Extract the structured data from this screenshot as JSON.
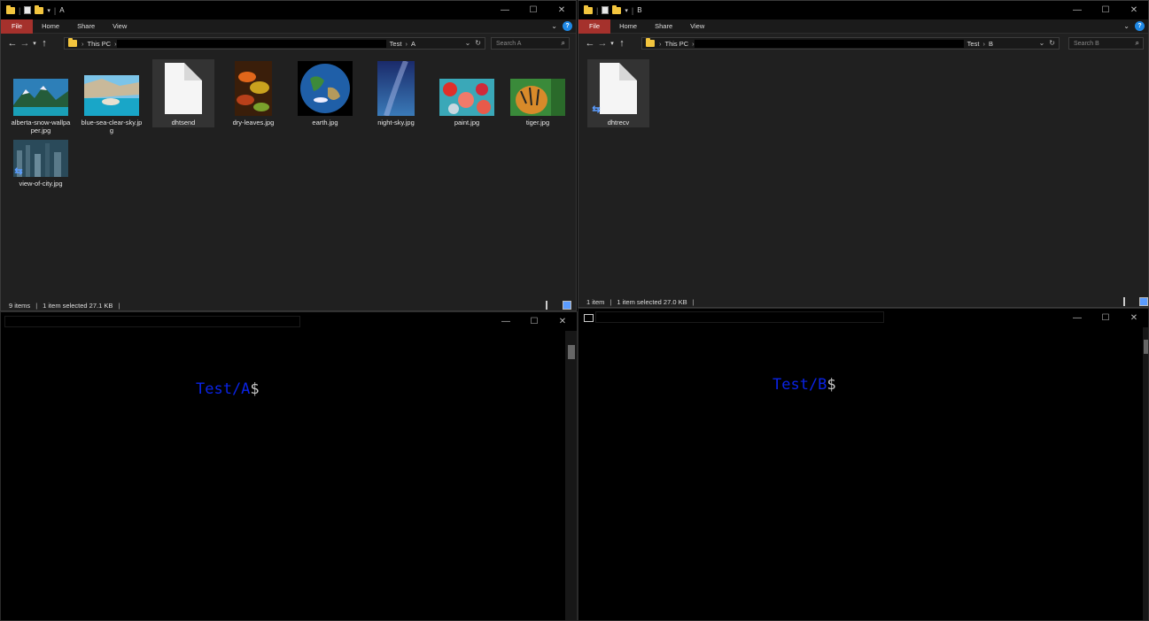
{
  "explorer_a": {
    "title": "A",
    "tabs": [
      "File",
      "Home",
      "Share",
      "View"
    ],
    "address": {
      "root": "This PC",
      "folder1": "Test",
      "folder2": "A"
    },
    "search_placeholder": "Search A",
    "files": [
      {
        "name": "alberta-snow-wallpaper.jpg",
        "type": "image"
      },
      {
        "name": "blue-sea-clear-sky.jpg",
        "type": "image"
      },
      {
        "name": "dhtsend",
        "type": "file"
      },
      {
        "name": "dry-leaves.jpg",
        "type": "image"
      },
      {
        "name": "earth.jpg",
        "type": "image"
      },
      {
        "name": "night-sky.jpg",
        "type": "image"
      },
      {
        "name": "paint.jpg",
        "type": "image"
      },
      {
        "name": "tiger.jpg",
        "type": "image"
      },
      {
        "name": "view-of-city.jpg",
        "type": "image"
      }
    ],
    "status": {
      "count": "9 items",
      "selection": "1 item selected  27.1 KB"
    }
  },
  "explorer_b": {
    "title": "B",
    "tabs": [
      "File",
      "Home",
      "Share",
      "View"
    ],
    "address": {
      "root": "This PC",
      "folder1": "Test",
      "folder2": "B"
    },
    "search_placeholder": "Search B",
    "files": [
      {
        "name": "dhtrecv",
        "type": "file"
      }
    ],
    "status": {
      "count": "1 item",
      "selection": "1 item selected  27.0 KB"
    }
  },
  "terminal_a": {
    "path": "Test/A",
    "symbol": "$"
  },
  "terminal_b": {
    "path": "Test/B",
    "symbol": "$"
  },
  "colors": {
    "file_tab": "#a5312c",
    "prompt_path": "#0a23e6",
    "prompt_symbol": "#c8c8c8",
    "folder": "#f3c53e",
    "window_bg": "#202020"
  },
  "icons": {
    "window_controls": [
      "minimize-icon",
      "maximize-icon",
      "close-icon"
    ],
    "nav": [
      "back-arrow-icon",
      "forward-arrow-icon",
      "recent-dropdown-icon",
      "up-arrow-icon"
    ],
    "sync_badge": "sync-pending-icon"
  }
}
